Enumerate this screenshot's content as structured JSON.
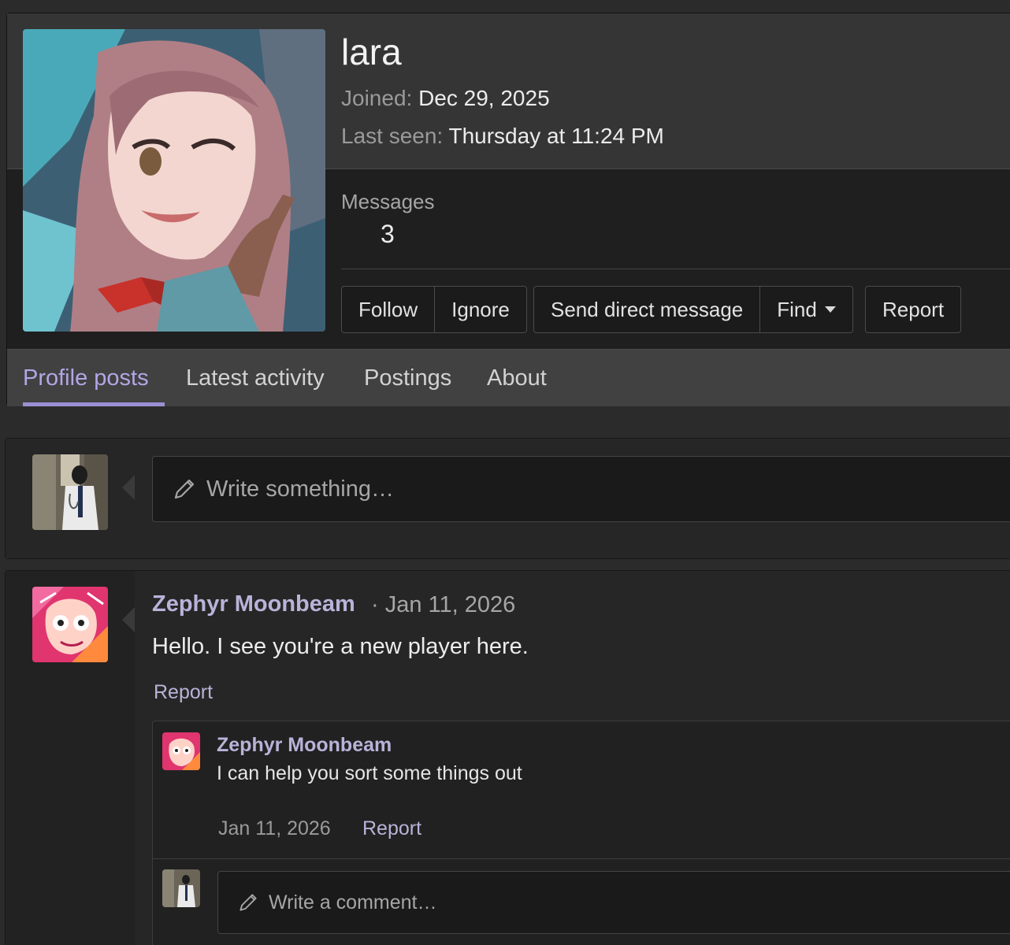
{
  "profile": {
    "username": "lara",
    "joined_label": "Joined:",
    "joined_value": "Dec 29, 2025",
    "last_seen_label": "Last seen:",
    "last_seen_value": "Thursday at 11:24 PM",
    "messages_label": "Messages",
    "messages_value": "3"
  },
  "actions": {
    "follow": "Follow",
    "ignore": "Ignore",
    "send_dm": "Send direct message",
    "find": "Find",
    "report": "Report"
  },
  "tabs": [
    {
      "label": "Profile posts",
      "active": true
    },
    {
      "label": "Latest activity",
      "active": false
    },
    {
      "label": "Postings",
      "active": false
    },
    {
      "label": "About",
      "active": false
    }
  ],
  "composer": {
    "placeholder": "Write something…"
  },
  "post": {
    "author": "Zephyr Moonbeam",
    "date": "· Jan 11, 2026",
    "body": "Hello. I see you're a new player here.",
    "report": "Report",
    "comment": {
      "author": "Zephyr Moonbeam",
      "text": "I can help you sort some things out",
      "date": "Jan 11, 2026",
      "report": "Report"
    },
    "comment_placeholder": "Write a comment…"
  },
  "colors": {
    "accent": "#9b8fd4",
    "link": "#b9b3d9",
    "background": "#2b2b2b"
  }
}
